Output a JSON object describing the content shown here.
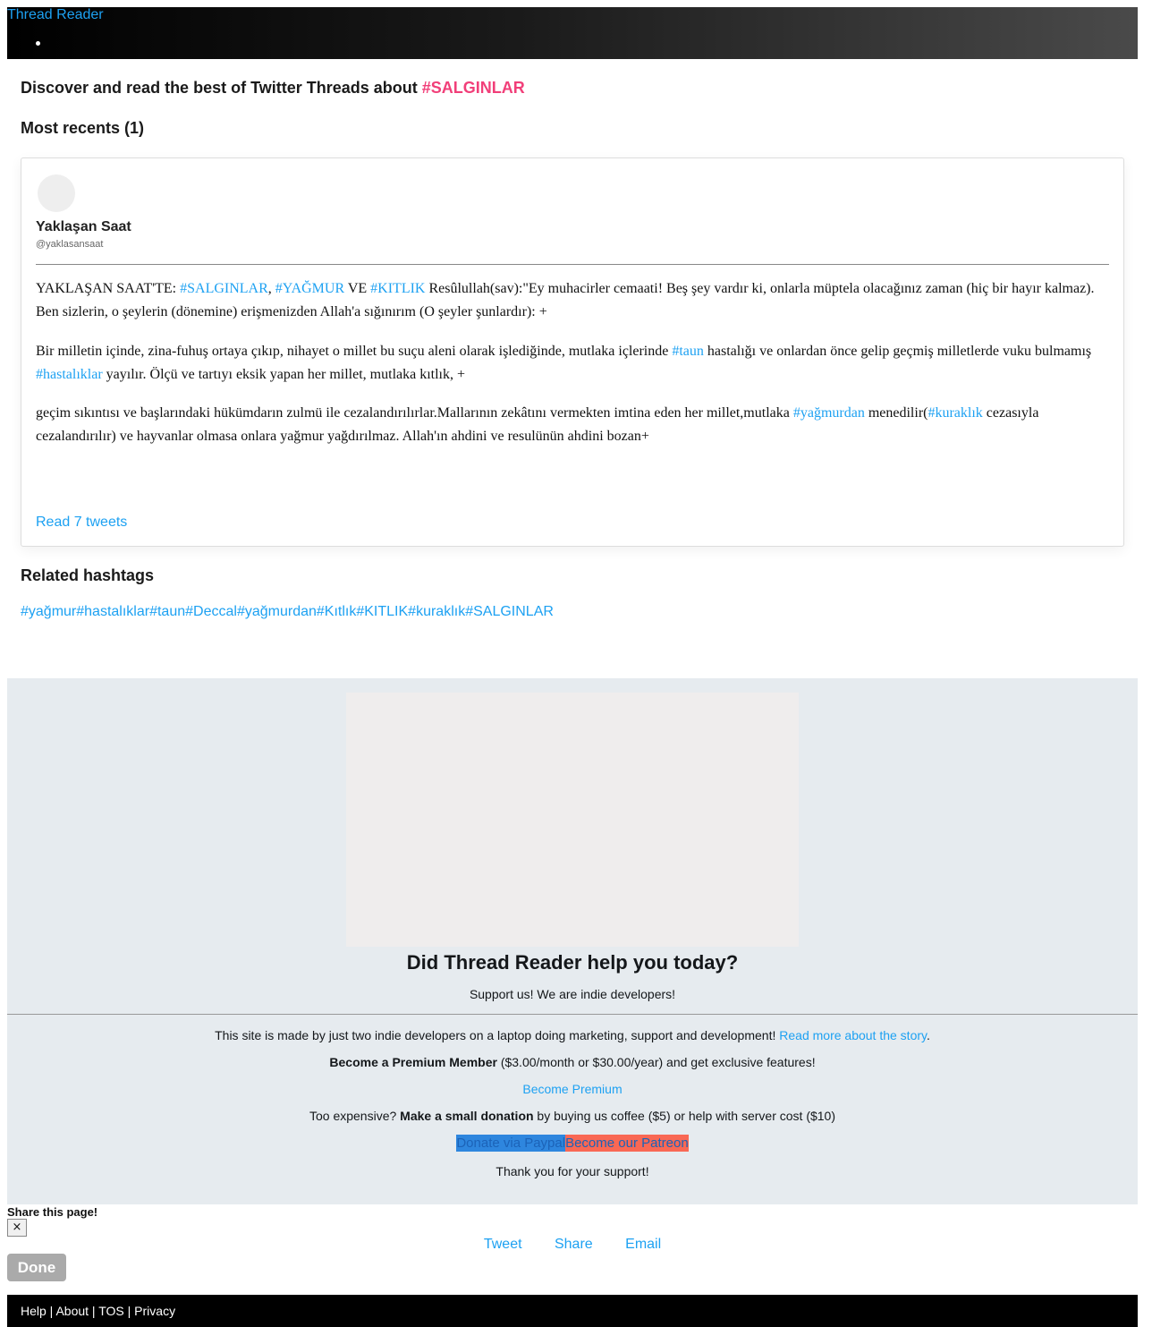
{
  "header": {
    "brand": "Thread Reader"
  },
  "page": {
    "discover_prefix": "Discover and read the best of Twitter Threads about ",
    "discover_tag": "#SALGINLAR",
    "most_recents": "Most recents (1)"
  },
  "thread": {
    "author_name": "Yaklaşan Saat",
    "author_handle": "@yaklasansaat",
    "tweet1": {
      "a": "YAKLAŞAN SAAT'TE: ",
      "tag1": "#SALGINLAR",
      "b": ", ",
      "tag2": "#YAĞMUR",
      "c": " VE ",
      "tag3": "#KITLIK",
      "d": " Resûlullah(sav):\"Ey muhacirler cemaati! Beş şey vardır ki, onlarla müptela olacağınız zaman (hiç bir hayır kalmaz). Ben sizlerin, o şeylerin (dönemine) erişmenizden Allah'a sığınırım (O şeyler şunlardır): +"
    },
    "tweet2": {
      "a": "Bir milletin içinde, zina-fuhuş ortaya çıkıp, nihayet o millet bu suçu aleni olarak işlediğinde, mutlaka içlerinde ",
      "tag1": "#taun",
      "b": " hastalığı ve onlardan önce gelip geçmiş milletlerde vuku bulmamış ",
      "tag2": "#hastalıklar",
      "c": " yayılır. Ölçü ve tartıyı eksik yapan her millet, mutlaka kıtlık, +"
    },
    "tweet3": {
      "a": "geçim sıkıntısı ve başlarındaki hükümdarın zulmü ile cezalandırılırlar.Mallarının zekâtını vermekten imtina eden her millet,mutlaka ",
      "tag1": "#yağmurdan",
      "b": " menedilir(",
      "tag2": "#kuraklık",
      "c": " cezasıyla cezalandırılır) ve hayvanlar olmasa onlara yağmur yağdırılmaz. Allah'ın ahdini ve resulünün ahdini bozan+"
    },
    "read_more": "Read 7 tweets"
  },
  "related": {
    "title": "Related hashtags",
    "tags": [
      "#yağmur",
      "#hastalıklar",
      "#taun",
      "#Deccal",
      "#yağmurdan",
      "#Kıtlık",
      "#KITLIK",
      "#kuraklık",
      "#SALGINLAR"
    ]
  },
  "support": {
    "title": "Did Thread Reader help you today?",
    "subtitle": "Support us! We are indie developers!",
    "story_text": "This site is made by just two indie developers on a laptop doing marketing, support and development! ",
    "story_link": "Read more about the story",
    "story_end": ".",
    "premium_bold": "Become a Premium Member",
    "premium_rest": " ($3.00/month or $30.00/year) and get exclusive features!",
    "premium_link": "Become Premium",
    "expensive_a": "Too expensive? ",
    "expensive_bold": "Make a small donation",
    "expensive_rest": " by buying us coffee ($5) or help with server cost ($10)",
    "paypal": "Donate via Paypal",
    "patreon": "Become our Patreon",
    "thanks": "Thank you for your support!"
  },
  "share": {
    "title": "Share this page!",
    "close": "×",
    "tweet": "Tweet",
    "share": "Share",
    "email": "Email",
    "done": "Done"
  },
  "footer": {
    "help": "Help",
    "about": "About",
    "tos": "TOS",
    "privacy": "Privacy",
    "sep": " | "
  }
}
